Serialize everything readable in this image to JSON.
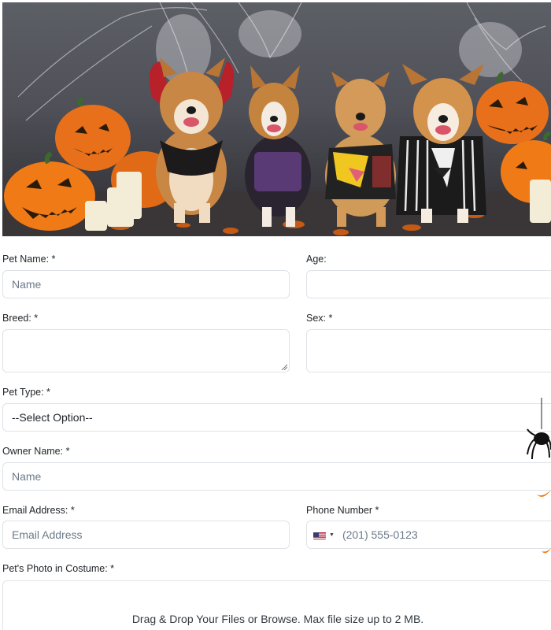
{
  "hero": {
    "image_alt": "Four corgi dogs in Halloween costumes with jack-o-lanterns and candles",
    "subject": "four dogs in costumes"
  },
  "form": {
    "pet_name": {
      "label": "Pet Name: *",
      "placeholder": "Name"
    },
    "age": {
      "label": "Age:",
      "placeholder": ""
    },
    "breed": {
      "label": "Breed: *",
      "placeholder": ""
    },
    "sex": {
      "label": "Sex: *",
      "placeholder": ""
    },
    "pet_type": {
      "label": "Pet Type: *",
      "selected": "--Select Option--"
    },
    "owner_name": {
      "label": "Owner Name: *",
      "placeholder": "Name"
    },
    "email": {
      "label": "Email Address: *",
      "placeholder": "Email Address"
    },
    "phone": {
      "label": "Phone Number *",
      "placeholder": "(201) 555-0123",
      "country_flag": "us-flag-icon"
    },
    "photo": {
      "label": "Pet's Photo in Costume: *",
      "dropzone_text": "Drag & Drop Your Files or Browse. Max file size up to 2 MB."
    }
  },
  "colors": {
    "border": "#dfe3e8",
    "placeholder": "#6c7a89",
    "pumpkin": "#f07a16"
  }
}
